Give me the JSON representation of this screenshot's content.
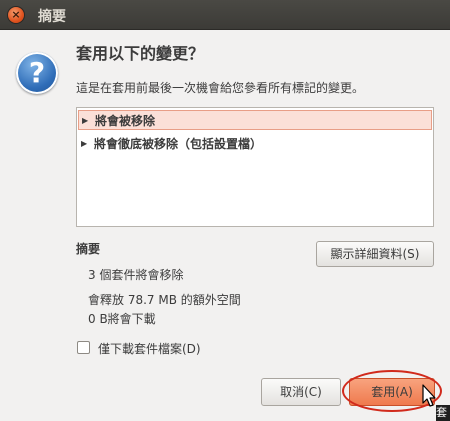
{
  "window": {
    "title": "摘要",
    "close_icon": "×"
  },
  "dialog": {
    "icon": "?",
    "heading": "套用以下的變更？",
    "subtext": "這是在套用前最後一次機會給您參看所有標記的變更。"
  },
  "changes": {
    "items": [
      {
        "label": "將會被移除",
        "selected": true
      },
      {
        "label": "將會徹底被移除（包括設置檔）",
        "selected": false
      }
    ]
  },
  "summary": {
    "label": "摘要",
    "lines": [
      "3 個套件將會移除",
      "會釋放 78.7 MB 的額外空間",
      "0  B將會下載"
    ],
    "details_button": "顯示詳細資料(S)"
  },
  "download_only": {
    "label": "僅下載套件檔案(D)",
    "checked": false
  },
  "buttons": {
    "cancel": "取消(C)",
    "apply": "套用(A)"
  },
  "overlay": {
    "tooltip_fragment": "套"
  },
  "colors": {
    "titlebar": "#3c3b37",
    "accent": "#ef7a4e",
    "highlight_ring": "#d12a1c"
  }
}
